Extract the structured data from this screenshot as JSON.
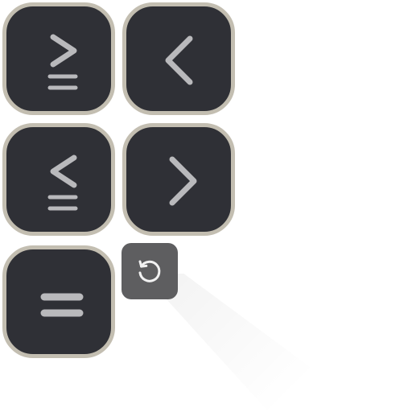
{
  "keypad": {
    "keys": [
      {
        "id": "greater-equal",
        "icon": "greater-than-or-equal-icon"
      },
      {
        "id": "less-than",
        "icon": "chevron-left-icon"
      },
      {
        "id": "less-equal",
        "icon": "less-than-or-equal-icon"
      },
      {
        "id": "greater-than",
        "icon": "chevron-right-icon"
      },
      {
        "id": "equals",
        "icon": "equals-icon"
      }
    ],
    "reset": {
      "icon": "reset-icon"
    }
  },
  "colors": {
    "key_background": "#2f3036",
    "key_border": "#c3beb1",
    "glyph": "#b9b9bc",
    "reset_background": "#5e5e60",
    "reset_glyph": "#f2f2f2"
  }
}
